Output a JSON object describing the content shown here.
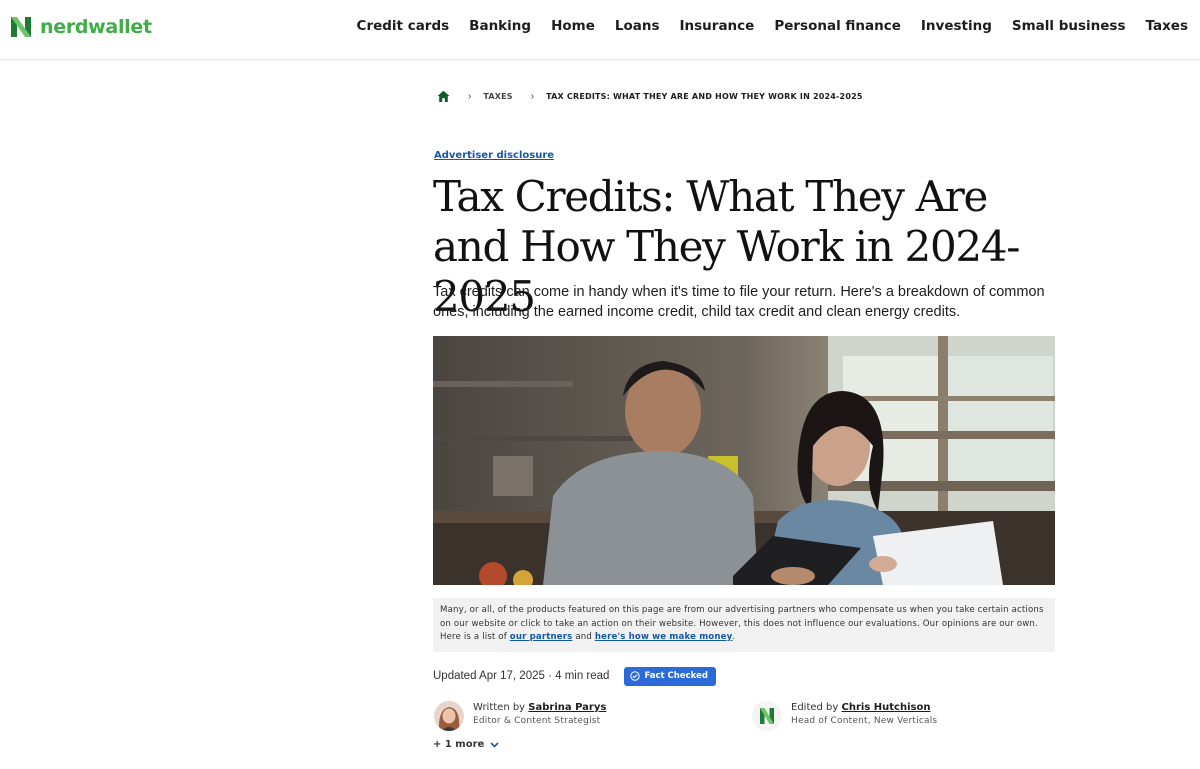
{
  "brand": {
    "name": "nerdwallet",
    "color": "#40ad48"
  },
  "nav": {
    "items": [
      "Credit cards",
      "Banking",
      "Home",
      "Loans",
      "Insurance",
      "Personal finance",
      "Investing",
      "Small business",
      "Taxes"
    ]
  },
  "breadcrumb": {
    "home_icon": "home-icon",
    "items": [
      "TAXES",
      "TAX CREDITS: WHAT THEY ARE AND HOW THEY WORK IN 2024-2025"
    ]
  },
  "article": {
    "disclosure": "Advertiser disclosure",
    "title": "Tax Credits: What They Are and How They Work in 2024-2025",
    "lede": "Tax credits can come in handy when it's time to file your return. Here's a breakdown of common ones, including the earned income credit, child tax credit and clean energy credits."
  },
  "ad_notice": {
    "text": "Many, or all, of the products featured on this page are from our advertising partners who compensate us when you take certain actions on our website or click to take an action on their website. However, this does not influence our evaluations. Our opinions are our own. Here is a list of ",
    "partners_link": "our partners",
    "conjunction": " and ",
    "money_link": "here's how we make money",
    "end": "."
  },
  "meta": {
    "updated": "Updated Apr 17, 2025 · 4 min read",
    "fact_checked": "Fact Checked",
    "accent": "#2b6ad8"
  },
  "authors": [
    {
      "prefix": "Written by ",
      "name": "Sabrina Parys",
      "role": "Editor & Content Strategist"
    },
    {
      "prefix": "Edited by ",
      "name": "Chris Hutchison",
      "role": "Head of Content, New Verticals"
    }
  ],
  "more_authors": "+ 1 more"
}
